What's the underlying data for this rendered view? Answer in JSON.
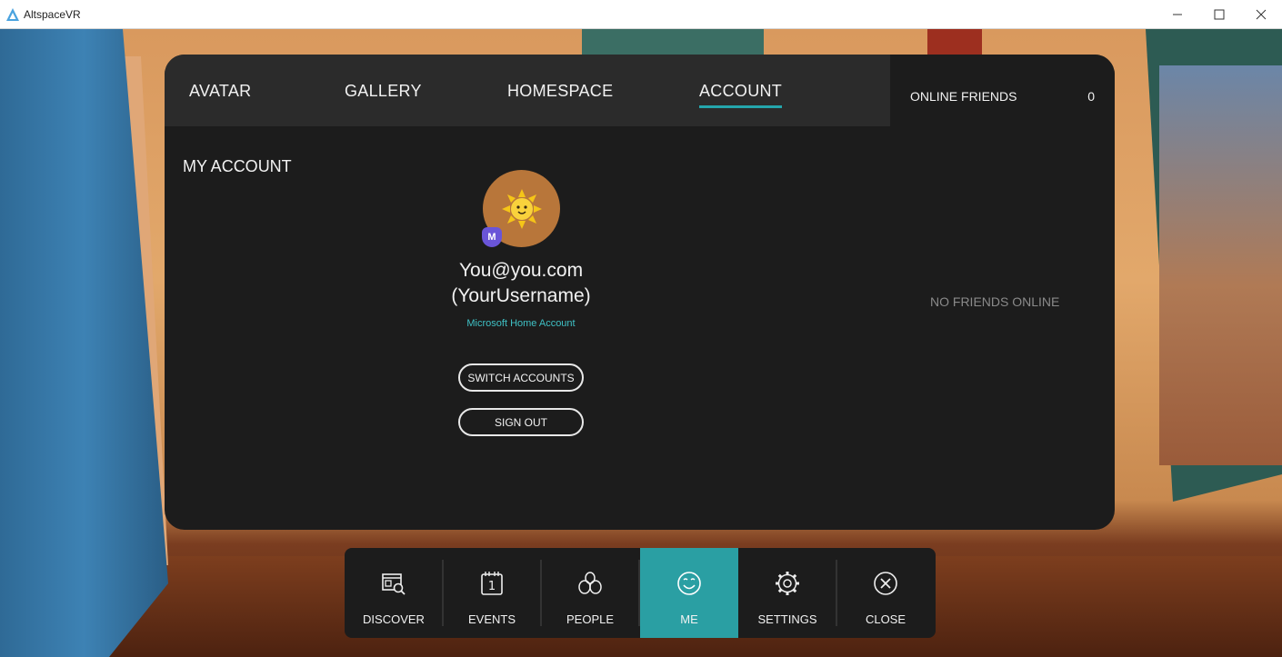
{
  "window": {
    "title": "AltspaceVR",
    "controls": [
      "minimize",
      "maximize",
      "close"
    ]
  },
  "tabs": [
    {
      "label": "AVATAR",
      "active": false
    },
    {
      "label": "GALLERY",
      "active": false
    },
    {
      "label": "HOMESPACE",
      "active": false
    },
    {
      "label": "ACCOUNT",
      "active": true
    }
  ],
  "friends": {
    "title": "ONLINE FRIENDS",
    "count": "0",
    "empty_message": "NO FRIENDS ONLINE"
  },
  "account": {
    "section_title": "MY ACCOUNT",
    "badge": "M",
    "email": "You@you.com",
    "username": "(YourUsername)",
    "account_type": "Microsoft Home Account",
    "switch_label": "SWITCH ACCOUNTS",
    "signout_label": "SIGN OUT"
  },
  "dock": [
    {
      "label": "DISCOVER",
      "icon": "discover-icon",
      "active": false
    },
    {
      "label": "EVENTS",
      "icon": "calendar-icon",
      "active": false
    },
    {
      "label": "PEOPLE",
      "icon": "people-icon",
      "active": false
    },
    {
      "label": "ME",
      "icon": "smiley-icon",
      "active": true
    },
    {
      "label": "SETTINGS",
      "icon": "gear-icon",
      "active": false
    },
    {
      "label": "CLOSE",
      "icon": "close-circle-icon",
      "active": false
    }
  ],
  "colors": {
    "accent": "#2a9fa3",
    "link": "#3fc1c5",
    "panel": "#1c1c1c",
    "badge": "#6a55d8"
  }
}
